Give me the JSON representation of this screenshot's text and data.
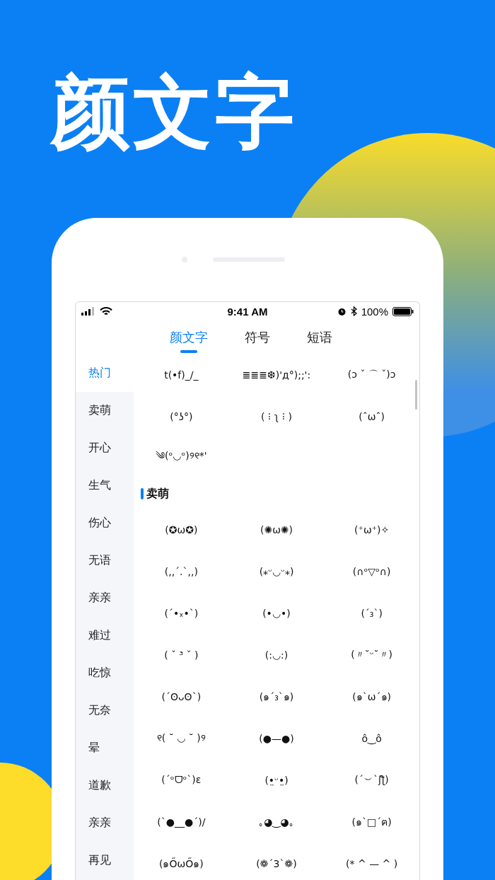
{
  "headline": "颜文字",
  "status_bar": {
    "time": "9:41 AM",
    "battery": "100%"
  },
  "tabs": [
    {
      "label": "颜文字",
      "selected": true
    },
    {
      "label": "符号",
      "selected": false
    },
    {
      "label": "短语",
      "selected": false
    }
  ],
  "sidebar": {
    "items": [
      {
        "label": "热门",
        "selected": true
      },
      {
        "label": "卖萌",
        "selected": false
      },
      {
        "label": "开心",
        "selected": false
      },
      {
        "label": "生气",
        "selected": false
      },
      {
        "label": "伤心",
        "selected": false
      },
      {
        "label": "无语",
        "selected": false
      },
      {
        "label": "亲亲",
        "selected": false
      },
      {
        "label": "难过",
        "selected": false
      },
      {
        "label": "吃惊",
        "selected": false
      },
      {
        "label": "无奈",
        "selected": false
      },
      {
        "label": "晕",
        "selected": false
      },
      {
        "label": "道歉",
        "selected": false
      },
      {
        "label": "亲亲",
        "selected": false
      },
      {
        "label": "再见",
        "selected": false
      }
    ]
  },
  "hot_items": [
    "t(•f)_/_",
    "≣≣≣❆)'д°);;':",
    "(ɔ ˇ ⌒ ˇ)ɔ",
    "(°ʖ°)",
    "( ⁝ ʅ ⁝ )",
    "(ˆωˆ)",
    "༄(ᵒ◡ᵒ)୨୧*'"
  ],
  "section": {
    "title": "卖萌",
    "items": [
      "(✪ω✪)",
      "(✺ω✺)",
      "(⁺ω⁺)✧",
      "(,,ˊ.ˋ,,)",
      "(⁎ᵕ◡ᵕ⁎)",
      "(∩ᵒ▽ᵒ∩)",
      "(´•ₓ•`)",
      "(•◡•)",
      "(ˊ₃ˋ)",
      "( ˇ ³ ˇ )",
      "(:◡:)",
      "(〃˘ᵕ˘〃)",
      "(´ʘᴗʘ`)",
      "(๑ˊ₃ˋ๑)",
      "(๑ˋωˊ๑)",
      "୧( ˘ ◡ ˘ )୨",
      "(●—●)",
      "ô‿ô",
      "(´ᵒᗜᵒ`)ɛ",
      "(•̤ᵕ•̤)",
      "(´︶`ʃƪ)",
      "(`●__●´)/",
      "｡◕‿◕｡",
      "(๑ˋ□ˊฅ)",
      "(๑ŐωŐ๑)",
      "(❁´3`❁)",
      "(* ^ — ^ )"
    ]
  }
}
